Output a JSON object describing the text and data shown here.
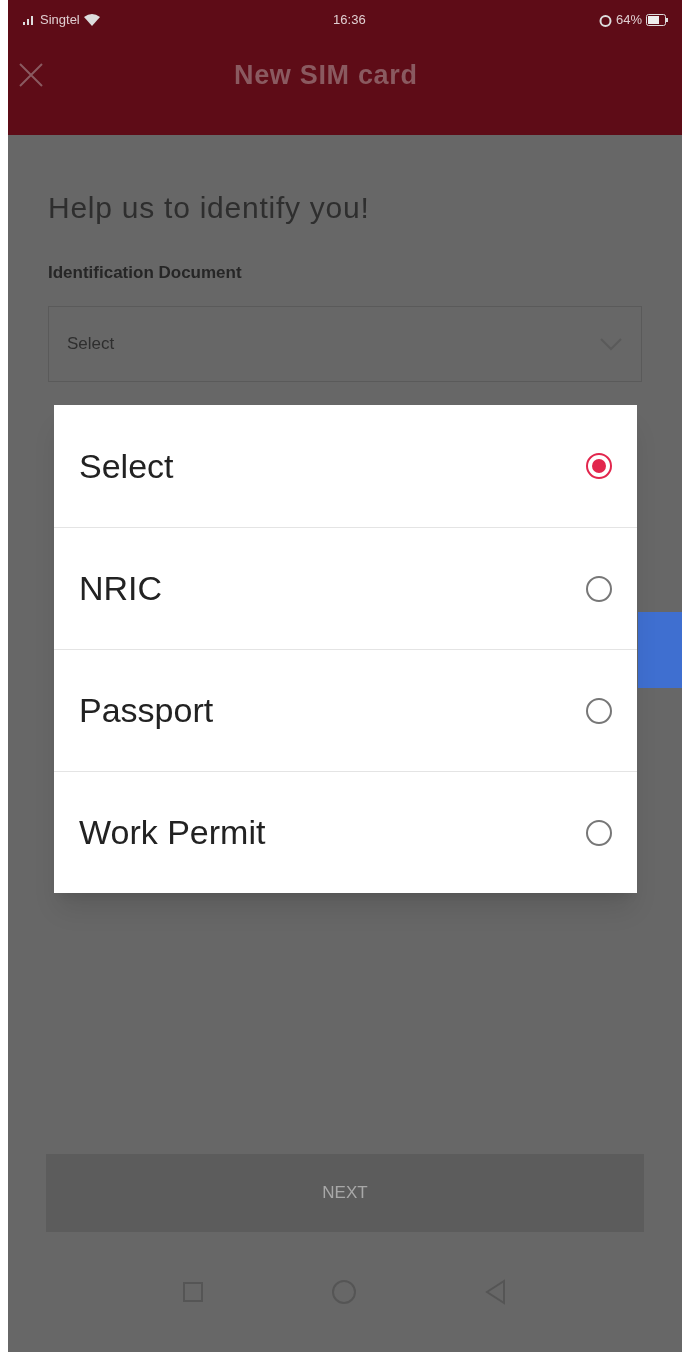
{
  "status_bar": {
    "carrier": "Singtel",
    "time": "16:36",
    "battery": "64%"
  },
  "header": {
    "title": "New SIM card"
  },
  "form": {
    "heading": "Help us to identify you!",
    "field_label": "Identification Document",
    "field_value": "Select"
  },
  "dialog": {
    "options": [
      {
        "label": "Select",
        "selected": true
      },
      {
        "label": "NRIC",
        "selected": false
      },
      {
        "label": "Passport",
        "selected": false
      },
      {
        "label": "Work Permit",
        "selected": false
      }
    ]
  },
  "button": {
    "label": "NEXT",
    "disabled": true
  }
}
